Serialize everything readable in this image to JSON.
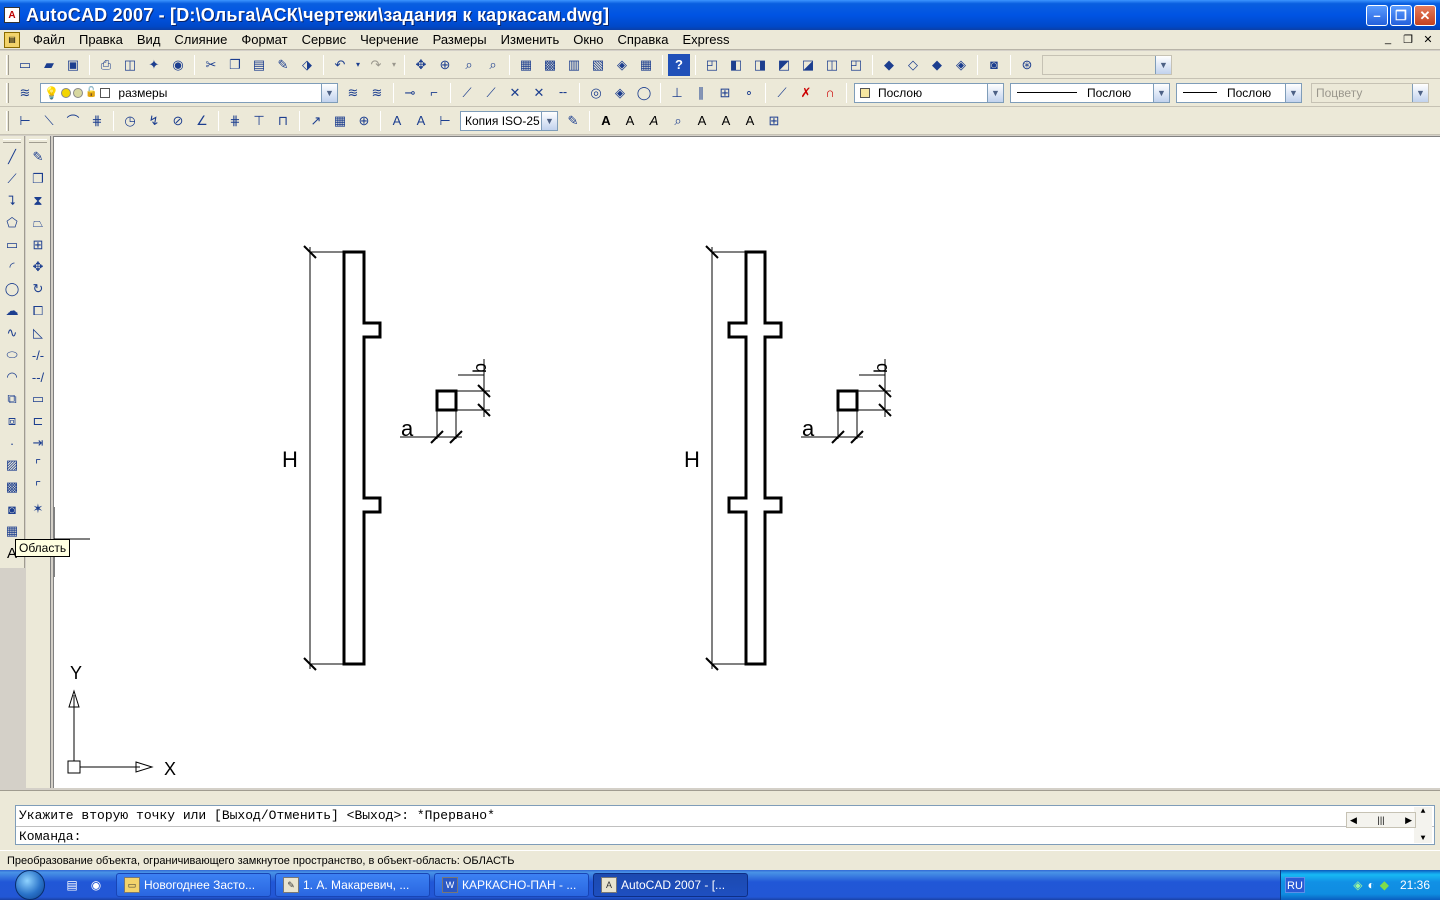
{
  "window": {
    "title": "AutoCAD 2007 - [D:\\Ольга\\АСК\\чертежи\\задания к каркасам.dwg]",
    "app_icon": "A"
  },
  "menu": {
    "items": [
      "Файл",
      "Правка",
      "Вид",
      "Слияние",
      "Формат",
      "Сервис",
      "Черчение",
      "Размеры",
      "Изменить",
      "Окно",
      "Справка",
      "Express"
    ]
  },
  "toolbars": {
    "layer_combo": "размеры",
    "color_combo": "Послою",
    "linetype_combo": "Послою",
    "lineweight_combo": "Послою",
    "plotstyle_combo": "Поцвету",
    "dimstyle_combo": "Копия ISO-25"
  },
  "drawing": {
    "label_H": "H",
    "label_a": "a",
    "label_b": "b",
    "ucs_x": "X",
    "ucs_y": "Y"
  },
  "tooltip": "Область",
  "left_toolbar_letter": "A",
  "command": {
    "history": "Укажите вторую точку или [Выход/Отменить] <Выход>: *Прервано*",
    "prompt": "Команда:",
    "input_value": ""
  },
  "status_text": "Преобразование объекта, ограничивающего замкнутое пространство, в объект-область:  ОБЛАСТЬ",
  "taskbar": {
    "buttons": [
      "Новогоднее Засто...",
      "1. А. Макаревич, ...",
      "КАРКАСНО-ПАН - ...",
      "AutoCAD 2007 - [..."
    ],
    "lang": "RU",
    "clock": "21:36"
  },
  "colors": {
    "title_blue": "#0054e3",
    "canvas_bg": "#ffffff",
    "toolbar_bg": "#ece9d8",
    "taskbar_blue": "#2257d5"
  }
}
